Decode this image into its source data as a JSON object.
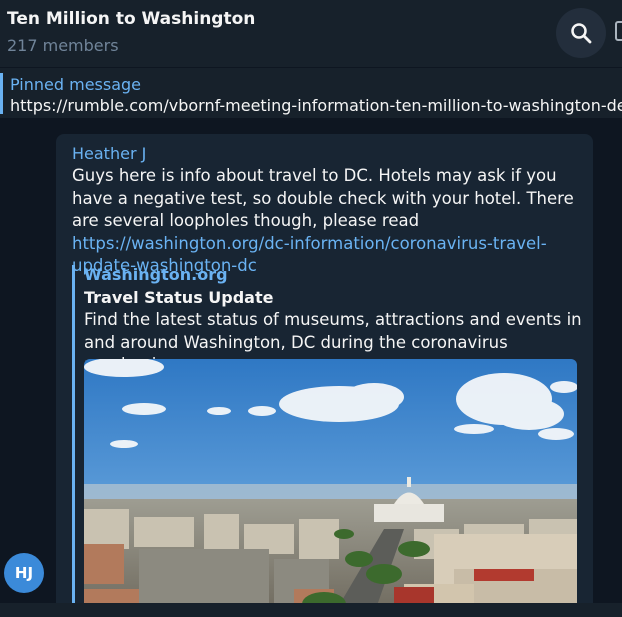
{
  "header": {
    "title": "Ten Million to Washington",
    "subtitle": "217 members",
    "search_icon": "search-icon",
    "more_icon": "more-icon"
  },
  "pinned": {
    "label": "Pinned message",
    "text": "https://rumble.com/vbornf-meeting-information-ten-million-to-washington-dece..."
  },
  "message": {
    "sender": "Heather J",
    "text": "Guys here is info about travel to DC. Hotels may ask if you have a negative test, so double check with your hotel. There are several loopholes though, please read ",
    "link": "https://washington.org/dc-information/coronavirus-travel-update-washington-dc",
    "avatar_initials": "HJ",
    "avatar_color": "#3b8ad9"
  },
  "preview": {
    "site_name": "Washington.org",
    "title": "Travel Status Update",
    "description": "Find the latest status of museums, attractions and events in and around Washington, DC during the coronavirus pandemic."
  },
  "colors": {
    "background": "#0e1621",
    "panel": "#17212b",
    "bubble": "#182533",
    "accent": "#6ab2f2",
    "secondary_text": "#708499"
  }
}
